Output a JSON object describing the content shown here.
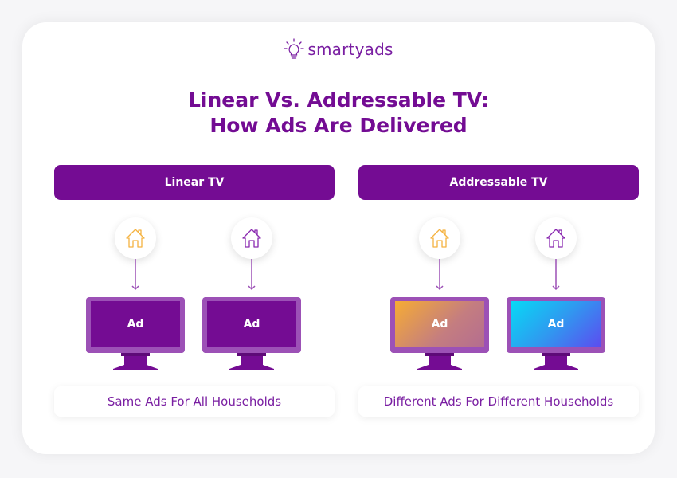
{
  "brand": {
    "name": "smartyads",
    "icon": "lightbulb-icon",
    "color": "#7a1fa2"
  },
  "title": {
    "line1": "Linear Vs. Addressable TV:",
    "line2": "How Ads Are Delivered"
  },
  "colors": {
    "primary": "#740c93",
    "monitor_frame": "#9c51b6",
    "house_orange": "#f5b240",
    "house_purple": "#8a2ab0"
  },
  "panels": [
    {
      "header": "Linear TV",
      "caption": "Same Ads For All Households",
      "households": [
        {
          "icon": "house-icon",
          "color": "orange",
          "ad_label": "Ad",
          "screen": "solid-purple"
        },
        {
          "icon": "house-icon",
          "color": "purple",
          "ad_label": "Ad",
          "screen": "solid-purple"
        }
      ]
    },
    {
      "header": "Addressable TV",
      "caption": "Different Ads For Different Households",
      "households": [
        {
          "icon": "house-icon",
          "color": "orange",
          "ad_label": "Ad",
          "screen": "orange-gradient"
        },
        {
          "icon": "house-icon",
          "color": "purple",
          "ad_label": "Ad",
          "screen": "blue-gradient"
        }
      ]
    }
  ]
}
